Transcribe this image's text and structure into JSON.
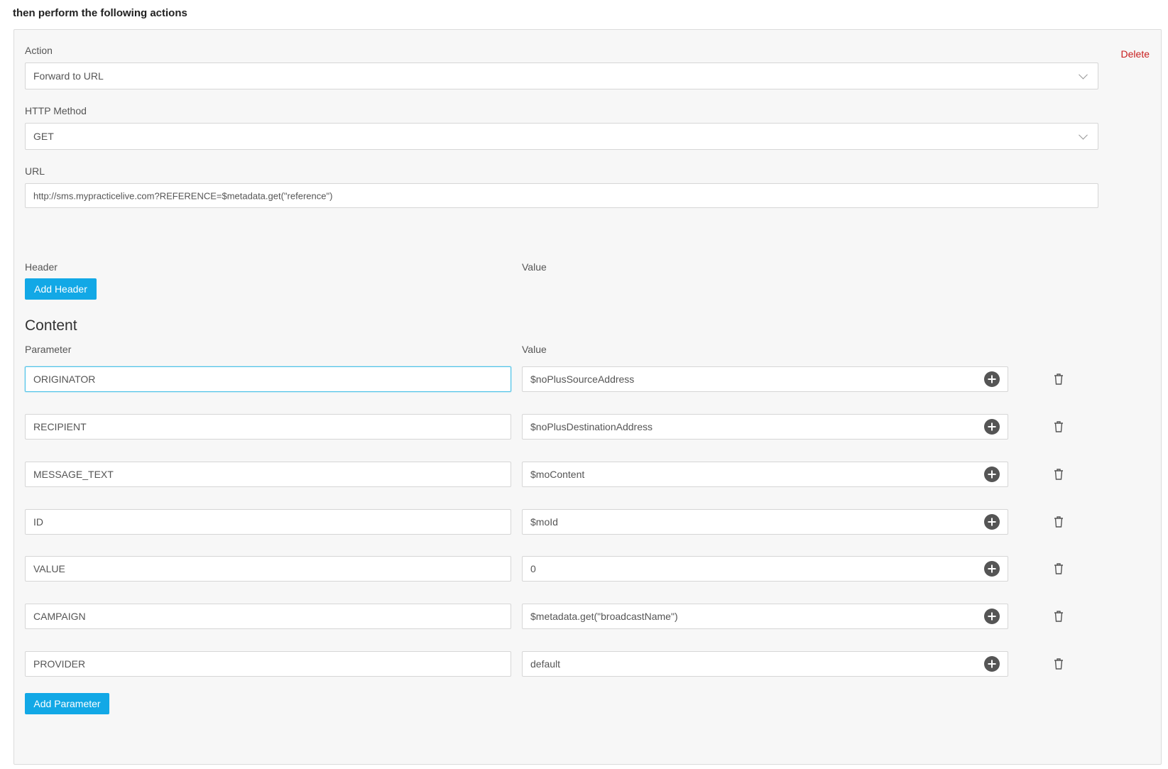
{
  "section_title": "then perform the following actions",
  "action": {
    "label": "Action",
    "delete_label": "Delete",
    "selected": "Forward to URL"
  },
  "http_method": {
    "label": "HTTP Method",
    "selected": "GET"
  },
  "url": {
    "label": "URL",
    "value": "http://sms.mypracticelive.com?REFERENCE=$metadata.get(\"reference\")"
  },
  "headers": {
    "header_label": "Header",
    "value_label": "Value",
    "add_button": "Add Header"
  },
  "content": {
    "title": "Content",
    "parameter_label": "Parameter",
    "value_label": "Value",
    "rows": [
      {
        "parameter": "ORIGINATOR",
        "value": "$noPlusSourceAddress"
      },
      {
        "parameter": "RECIPIENT",
        "value": "$noPlusDestinationAddress"
      },
      {
        "parameter": "MESSAGE_TEXT",
        "value": "$moContent"
      },
      {
        "parameter": "ID",
        "value": "$moId"
      },
      {
        "parameter": "VALUE",
        "value": "0"
      },
      {
        "parameter": "CAMPAIGN",
        "value": "$metadata.get(\"broadcastName\")"
      },
      {
        "parameter": "PROVIDER",
        "value": "default"
      }
    ],
    "add_button": "Add Parameter"
  },
  "icons": {
    "select_caret": "chevron-down-icon",
    "insert_variable": "plus-circle-icon",
    "remove_row": "trash-icon"
  },
  "colors": {
    "primary_button": "#12a8e6",
    "delete_link": "#c81e1e",
    "focus_border": "#4fc3e8"
  }
}
